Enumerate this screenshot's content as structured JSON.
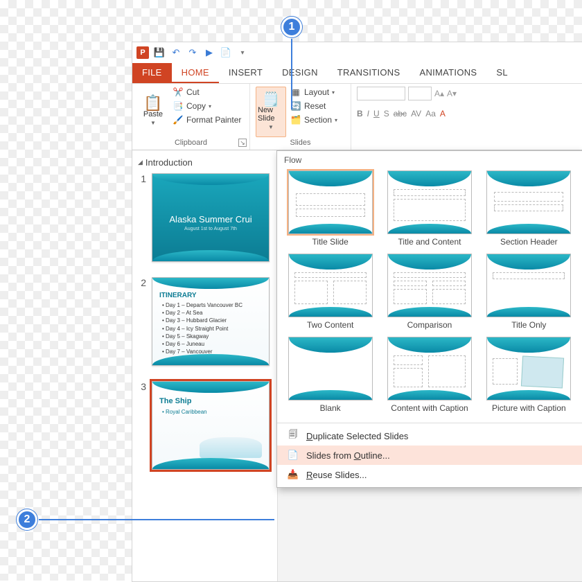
{
  "qat": {
    "save": "💾",
    "undo": "↶",
    "redo": "↷",
    "start": "▶",
    "touch": "📄"
  },
  "tabs": {
    "file": "FILE",
    "home": "HOME",
    "insert": "INSERT",
    "design": "DESIGN",
    "transitions": "TRANSITIONS",
    "animations": "ANIMATIONS",
    "slideshow": "SL"
  },
  "ribbon": {
    "paste": "Paste",
    "cut": "Cut",
    "copy": "Copy",
    "formatpainter": "Format Painter",
    "clipboard_label": "Clipboard",
    "newslide": "New Slide",
    "layout": "Layout",
    "reset": "Reset",
    "section": "Section",
    "slides_label": "Slides",
    "bold": "B",
    "italic": "I",
    "underline": "U",
    "shadow": "S",
    "strike": "abc",
    "spacing": "AV",
    "case": "Aa",
    "clear": "A"
  },
  "outline": {
    "section": "Introduction",
    "slides": [
      {
        "num": "1",
        "title": "Alaska Summer Crui",
        "subtitle": "August 1st to August 7th"
      },
      {
        "num": "2",
        "heading": "ITINERARY",
        "bullets": [
          "Day 1 – Departs Vancouver BC",
          "Day 2 – At Sea",
          "Day 3 – Hubbard Glacier",
          "Day 4 – Icy Straight Point",
          "Day 5 – Skagway",
          "Day 6 – Juneau",
          "Day 7 – Vancouver"
        ]
      },
      {
        "num": "3",
        "heading": "The Ship",
        "bullets": [
          "Royal Caribbean"
        ]
      }
    ]
  },
  "gallery": {
    "title": "Flow",
    "layouts": [
      "Title Slide",
      "Title and Content",
      "Section Header",
      "Two Content",
      "Comparison",
      "Title Only",
      "Blank",
      "Content with Caption",
      "Picture with Caption"
    ],
    "menu": {
      "duplicate_pre": "",
      "duplicate_key": "D",
      "duplicate_post": "uplicate Selected Slides",
      "outline_pre": "Slides from ",
      "outline_key": "O",
      "outline_post": "utline...",
      "reuse_pre": "",
      "reuse_key": "R",
      "reuse_post": "euse Slides..."
    }
  },
  "callouts": {
    "one": "1",
    "two": "2"
  }
}
